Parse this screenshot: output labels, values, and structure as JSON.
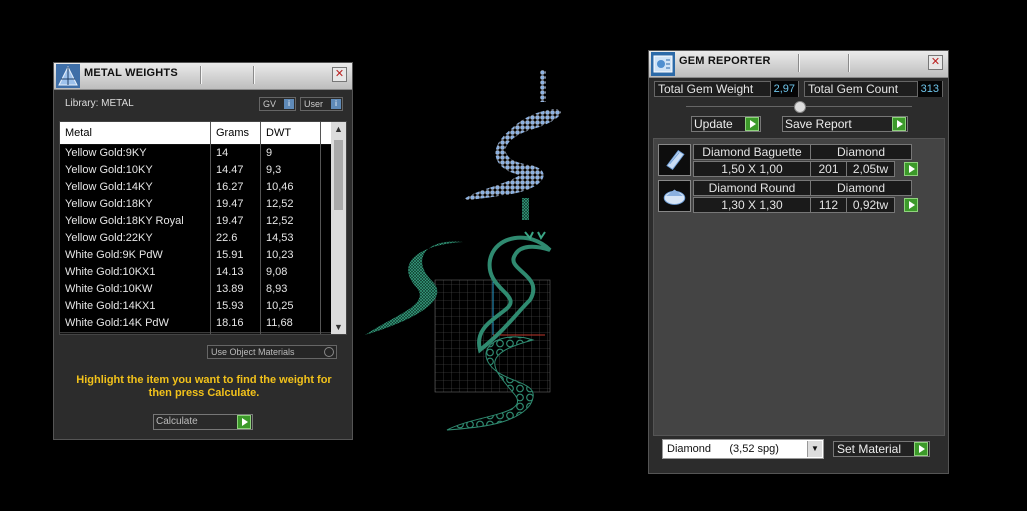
{
  "metal_weights": {
    "title": "METAL WEIGHTS",
    "library_label": "Library: METAL",
    "toggle_gv": "GV",
    "toggle_user": "User",
    "info_glyph": "i",
    "columns": [
      "Metal",
      "Grams",
      "DWT"
    ],
    "rows": [
      [
        "Yellow Gold:9KY",
        "14",
        "9"
      ],
      [
        "Yellow Gold:10KY",
        "14.47",
        "9,3"
      ],
      [
        "Yellow Gold:14KY",
        "16.27",
        "10,46"
      ],
      [
        "Yellow Gold:18KY",
        "19.47",
        "12,52"
      ],
      [
        "Yellow Gold:18KY Royal",
        "19.47",
        "12,52"
      ],
      [
        "Yellow Gold:22KY",
        "22.6",
        "14,53"
      ],
      [
        "White Gold:9K PdW",
        "15.91",
        "10,23"
      ],
      [
        "White Gold:10KX1",
        "14.13",
        "9,08"
      ],
      [
        "White Gold:10KW",
        "13.89",
        "8,93"
      ],
      [
        "White Gold:14KX1",
        "15.93",
        "10,25"
      ],
      [
        "White Gold:14K PdW",
        "18.16",
        "11,68"
      ]
    ],
    "use_object_materials": "Use Object Materials",
    "hint": "Highlight the item you want to find the weight for then press Calculate.",
    "calculate_label": "Calculate",
    "close_glyph": "✕"
  },
  "gem_reporter": {
    "title": "GEM REPORTER",
    "total_weight_label": "Total Gem Weight",
    "total_weight_value": "2,97",
    "total_count_label": "Total Gem Count",
    "total_count_value": "313",
    "update_label": "Update",
    "save_report_label": "Save Report",
    "gems": [
      {
        "name": "Diamond Baguette",
        "material": "Diamond",
        "size": "1,50 X 1,00",
        "count": "201",
        "weight": "2,05tw"
      },
      {
        "name": "Diamond Round",
        "material": "Diamond",
        "size": "1,30 X 1,30",
        "count": "112",
        "weight": "0,92tw"
      }
    ],
    "material_selected": "Diamond      (3,52 spg)",
    "set_material_label": "Set Material",
    "close_glyph": "✕",
    "dropdown_glyph": "▼"
  },
  "colors": {
    "accent_green": "#3c9a2a",
    "hint_yellow": "#f2c21b",
    "value_blue": "#6ec4ea",
    "mesh_green": "#2f8a70",
    "mesh_blue": "#8ab0e0"
  }
}
